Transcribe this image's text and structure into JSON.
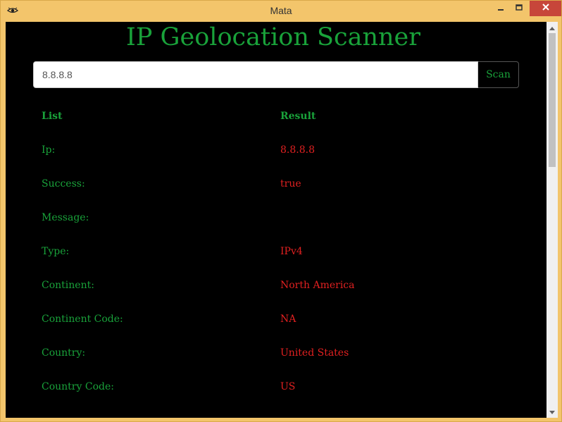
{
  "window": {
    "title": "Mata",
    "icons": {
      "app": "eye-icon",
      "minimize": "minimize-icon",
      "maximize": "maximize-icon",
      "close": "close-icon"
    },
    "frame_color": "#f3c56b",
    "close_color": "#c7463a"
  },
  "page": {
    "title": "IP Geolocation Scanner",
    "title_color": "#19a23a"
  },
  "search": {
    "value": "8.8.8.8",
    "button_label": "Scan"
  },
  "results": {
    "header": {
      "key": "List",
      "value": "Result"
    },
    "key_color": "#19a23a",
    "value_color": "#e02020",
    "rows": [
      {
        "key": "Ip:",
        "value": "8.8.8.8"
      },
      {
        "key": "Success:",
        "value": "true"
      },
      {
        "key": "Message:",
        "value": ""
      },
      {
        "key": "Type:",
        "value": "IPv4"
      },
      {
        "key": "Continent:",
        "value": "North America"
      },
      {
        "key": "Continent Code:",
        "value": "NA"
      },
      {
        "key": "Country:",
        "value": "United States"
      },
      {
        "key": "Country Code:",
        "value": "US"
      }
    ]
  },
  "scrollbar": {
    "up_icon": "scroll-up-arrow-icon",
    "down_icon": "scroll-down-arrow-icon"
  }
}
